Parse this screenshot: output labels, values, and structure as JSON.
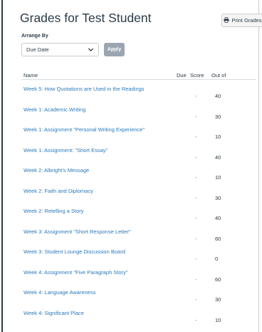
{
  "page": {
    "title": "Grades for Test Student"
  },
  "toolbar": {
    "print_label": "Print Grades"
  },
  "arrange": {
    "label": "Arrange By",
    "selected": "Due Date",
    "apply_label": "Apply"
  },
  "table": {
    "headers": {
      "name": "Name",
      "due": "Due",
      "score": "Score",
      "out_of": "Out of"
    },
    "rows": [
      {
        "name": "Week 5: How Quotations are Used in the Readings",
        "score": "-",
        "out_of": "40"
      },
      {
        "name": "Week 1: Academic Writing",
        "score": "-",
        "out_of": "30"
      },
      {
        "name": "Week 1: Assignment \"Personal Writing Experience\"",
        "score": "-",
        "out_of": "10"
      },
      {
        "name": "Week 1: Assignment: \"Short Essay\"",
        "score": "-",
        "out_of": "40"
      },
      {
        "name": "Week 2: Albright's Message",
        "score": "-",
        "out_of": "10"
      },
      {
        "name": "Week 2: Faith and Diplomacy",
        "score": "-",
        "out_of": "30"
      },
      {
        "name": "Week 2: Retelling a Story",
        "score": "-",
        "out_of": "40"
      },
      {
        "name": "Week 3: Assignment \"Short Response Letter\"",
        "score": "-",
        "out_of": "60"
      },
      {
        "name": "Week 3: Student Lounge Discussion Board",
        "score": "-",
        "out_of": "0"
      },
      {
        "name": "Week 4: Assignment \"Five Paragraph Story\"",
        "score": "-",
        "out_of": "60"
      },
      {
        "name": "Week 4: Language Awareness",
        "score": "-",
        "out_of": "30"
      },
      {
        "name": "Week 4: Significant Place",
        "score": "-",
        "out_of": "10"
      }
    ]
  },
  "colors": {
    "link": "#2b7abc",
    "text": "#2d3b45",
    "apply_button": "#9ba5b1"
  }
}
